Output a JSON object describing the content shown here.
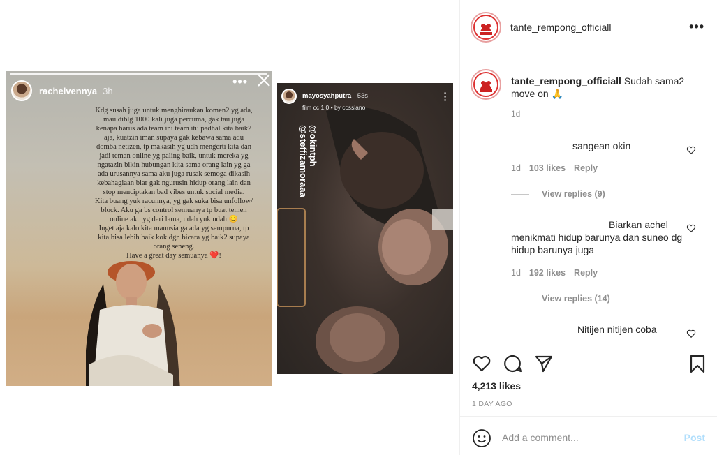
{
  "story_left": {
    "username": "rachelvennya",
    "time": "3h",
    "text": [
      "Kdg susah juga untuk menghiraukan komen2 yg ada,",
      "mau diblg 1000 kali juga percuma, gak tau juga",
      "kenapa harus ada team ini team itu padhal kita baik2",
      "aja, kuatzin iman supaya gak kebawa sama adu",
      "domba netizen, tp makasih yg udh mengerti kita dan",
      "jadi teman online yg paling baik, untuk mereka yg",
      "ngatazin bikin hubungan kita sama orang lain yg ga",
      "ada urusannya sama aku juga rusak semoga dikasih",
      "kebahagiaan biar gak ngurusin hidup orang lain dan",
      "stop menciptakan bad vibes untuk social media.",
      "Kita buang yuk racunnya, yg gak suka bisa unfollow/",
      "block. Aku ga bs control semuanya tp buat temen",
      "online aku yg dari lama, udah yuk udah 😊",
      "Inget aja kalo kita manusia ga ada yg sempurna, tp",
      "kita bisa lebih baik kok dgn bicara yg baik2 supaya",
      "orang seneng.",
      "Have a great day semuanya ❤️!"
    ]
  },
  "story_right": {
    "username": "mayosyahputra",
    "time": "53s",
    "filter": "film cc 1.0 • by ccssiano",
    "tags": [
      "@okintph",
      "@steffizamoraaa"
    ]
  },
  "header": {
    "username": "tante_rempong_officiall",
    "more_icon": "more-horizontal-icon"
  },
  "caption": {
    "username": "tante_rempong_officiall",
    "text": "Sudah sama2 move on 🙏",
    "time": "1d"
  },
  "comments": [
    {
      "text": "sangean okin",
      "time": "1d",
      "likes": "103 likes",
      "reply": "Reply",
      "view_replies": "View replies (9)"
    },
    {
      "text": "Biarkan achel menikmati hidup barunya dan suneo dg hidup barunya juga",
      "time": "1d",
      "likes": "192 likes",
      "reply": "Reply",
      "view_replies": "View replies (14)"
    },
    {
      "text": "Nitijen nitijen coba"
    }
  ],
  "actions": {
    "likes": "4,213 likes",
    "date": "1 DAY AGO"
  },
  "add_comment": {
    "placeholder": "Add a comment...",
    "post_label": "Post"
  },
  "colors": {
    "link_disabled": "#b2dffc",
    "muted": "#8e8e8e",
    "text": "#262626",
    "border": "#efefef"
  }
}
